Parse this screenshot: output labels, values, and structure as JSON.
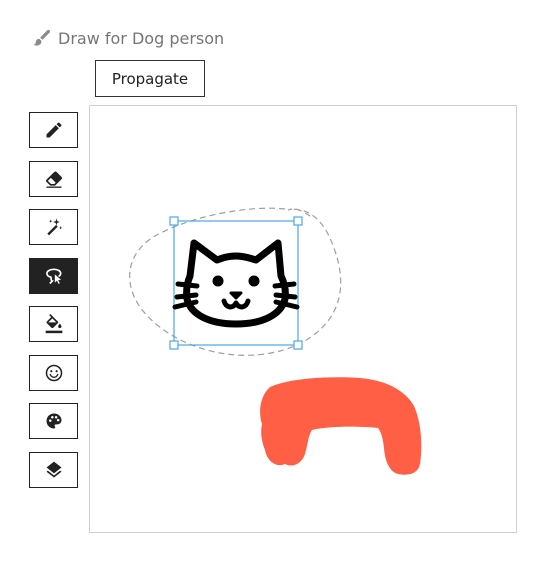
{
  "header": {
    "title": "Draw for Dog person",
    "icon": "brush-icon",
    "color": "#757575"
  },
  "propagate_button": {
    "label": "Propagate"
  },
  "toolbar": {
    "tools": [
      {
        "name": "pencil",
        "icon": "pencil-icon",
        "active": false
      },
      {
        "name": "eraser",
        "icon": "eraser-icon",
        "active": false
      },
      {
        "name": "magic-wand",
        "icon": "magic-wand-icon",
        "active": false
      },
      {
        "name": "lasso",
        "icon": "lasso-icon",
        "active": true
      },
      {
        "name": "fill",
        "icon": "paint-bucket-icon",
        "active": false
      },
      {
        "name": "emoji",
        "icon": "smiley-icon",
        "active": false
      },
      {
        "name": "color",
        "icon": "palette-icon",
        "active": false
      },
      {
        "name": "layers",
        "icon": "layers-icon",
        "active": false
      }
    ]
  },
  "canvas": {
    "objects": [
      {
        "type": "emoji",
        "content": "cat-face",
        "selected": true
      },
      {
        "type": "stroke",
        "color": "#ff5f45"
      }
    ],
    "selection_color": "#4aa8e8",
    "lasso_color": "#9e9e9e"
  }
}
